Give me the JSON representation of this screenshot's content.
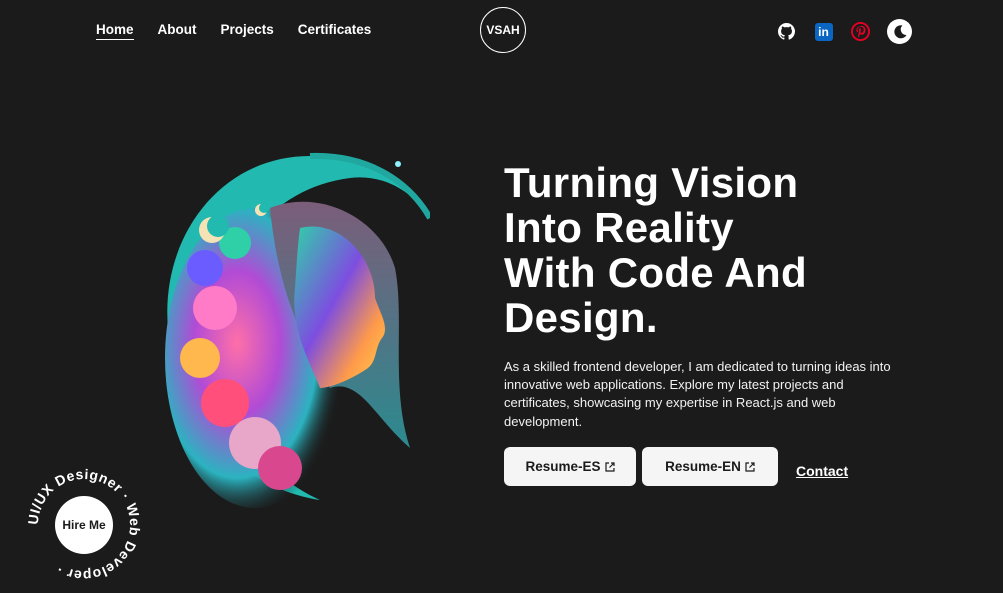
{
  "nav": {
    "links": [
      {
        "label": "Home",
        "active": true
      },
      {
        "label": "About"
      },
      {
        "label": "Projects"
      },
      {
        "label": "Certificates"
      }
    ],
    "logo": "VSAH",
    "socials": [
      "github-icon",
      "linkedin-icon",
      "pinterest-icon"
    ],
    "linkedin_glyph": "in",
    "theme_icon": "moon-icon"
  },
  "hero": {
    "headline_lines": [
      "Turning Vision",
      "Into Reality",
      "With Code And",
      "Design."
    ],
    "intro": "As a skilled frontend developer, I am dedicated to turning ideas into innovative web applications. Explore my latest projects and certificates, showcasing my expertise in React.js and web development.",
    "buttons": {
      "resume_es": "Resume-ES",
      "resume_en": "Resume-EN",
      "contact": "Contact"
    },
    "art_description_icon": "profile-portrait-illustration"
  },
  "hire": {
    "label": "Hire Me",
    "ring_text": "UI/UX Designer · Web Developer · "
  },
  "colors": {
    "background": "#1b1b1b",
    "text": "#ffffff",
    "button_bg": "#f5f5f5",
    "linkedin": "#0a66c2",
    "pinterest": "#e60023"
  }
}
